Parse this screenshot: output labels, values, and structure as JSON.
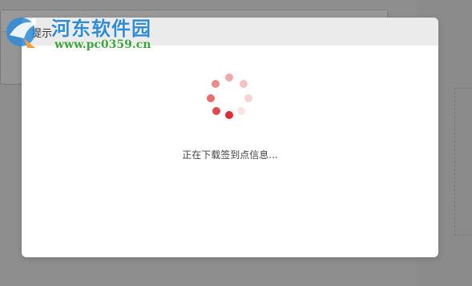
{
  "background": {
    "window_label": "提示"
  },
  "watermark": {
    "title": "河东软件园",
    "url": "www.pc0359.cn"
  },
  "dialog": {
    "title": "提示",
    "status": "正在下载签到点信息...",
    "spinner_colors": [
      "#e02d33",
      "#e24a4f",
      "#ea6c70",
      "#ee8a8c",
      "#f1a8a9",
      "#f4c2c2",
      "#f6d3d3",
      "#f9e3e3"
    ]
  }
}
